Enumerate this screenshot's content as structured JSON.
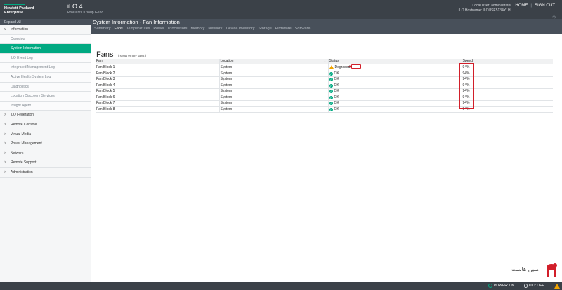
{
  "header": {
    "brand_line1": "Hewlett Packard",
    "brand_line2": "Enterprise",
    "product": "iLO 4",
    "server_model": "ProLiant DL380p Gen8",
    "local_user": "Local User: administrator",
    "hostname": "iLO Hostname: ILOUSE5134Y1H.",
    "home_label": "HOME",
    "signout_label": "SIGN OUT"
  },
  "subheader": {
    "expand_all": "Expand All",
    "page_title": "System Information - Fan Information",
    "tabs": [
      "Summary",
      "Fans",
      "Temperatures",
      "Power",
      "Processors",
      "Memory",
      "Network",
      "Device Inventory",
      "Storage",
      "Firmware",
      "Software"
    ],
    "active_tab": "Fans",
    "help": "?"
  },
  "sidebar": {
    "items": [
      {
        "label": "Information",
        "type": "top",
        "caret": "v"
      },
      {
        "label": "Overview",
        "type": "sub"
      },
      {
        "label": "System Information",
        "type": "selected"
      },
      {
        "label": "iLO Event Log",
        "type": "sub"
      },
      {
        "label": "Integrated Management Log",
        "type": "sub"
      },
      {
        "label": "Active Health System Log",
        "type": "sub"
      },
      {
        "label": "Diagnostics",
        "type": "sub"
      },
      {
        "label": "Location Discovery Services",
        "type": "sub"
      },
      {
        "label": "Insight Agent",
        "type": "sub"
      },
      {
        "label": "iLO Federation",
        "type": "top",
        "caret": ">"
      },
      {
        "label": "Remote Console",
        "type": "top",
        "caret": ">"
      },
      {
        "label": "Virtual Media",
        "type": "top",
        "caret": ">"
      },
      {
        "label": "Power Management",
        "type": "top",
        "caret": ">"
      },
      {
        "label": "Network",
        "type": "top",
        "caret": ">"
      },
      {
        "label": "Remote Support",
        "type": "top",
        "caret": ">"
      },
      {
        "label": "Administration",
        "type": "top",
        "caret": ">"
      }
    ]
  },
  "main": {
    "heading": "Fans",
    "show_empty_bays": "( show empty bays )",
    "columns": [
      "Fan",
      "Location",
      "Status",
      "Speed"
    ],
    "rows": [
      {
        "fan": "Fan Block 1",
        "location": "System",
        "status": "Degraded",
        "state": "warn",
        "speed": "94%"
      },
      {
        "fan": "Fan Block 2",
        "location": "System",
        "status": "OK",
        "state": "ok",
        "speed": "94%"
      },
      {
        "fan": "Fan Block 3",
        "location": "System",
        "status": "OK",
        "state": "ok",
        "speed": "94%"
      },
      {
        "fan": "Fan Block 4",
        "location": "System",
        "status": "OK",
        "state": "ok",
        "speed": "94%"
      },
      {
        "fan": "Fan Block 5",
        "location": "System",
        "status": "OK",
        "state": "ok",
        "speed": "94%"
      },
      {
        "fan": "Fan Block 6",
        "location": "System",
        "status": "OK",
        "state": "ok",
        "speed": "94%"
      },
      {
        "fan": "Fan Block 7",
        "location": "System",
        "status": "OK",
        "state": "ok",
        "speed": "94%"
      },
      {
        "fan": "Fan Block 8",
        "location": "System",
        "status": "OK",
        "state": "ok",
        "speed": "94%"
      }
    ]
  },
  "footer": {
    "power": "POWER: ON",
    "uid": "UID: OFF"
  },
  "watermark": {
    "text": "مبین هاست"
  },
  "colors": {
    "accent": "#01a982",
    "header_bg": "#3b4148",
    "annotation_red": "#d21f2a",
    "warning": "#f0a400"
  }
}
